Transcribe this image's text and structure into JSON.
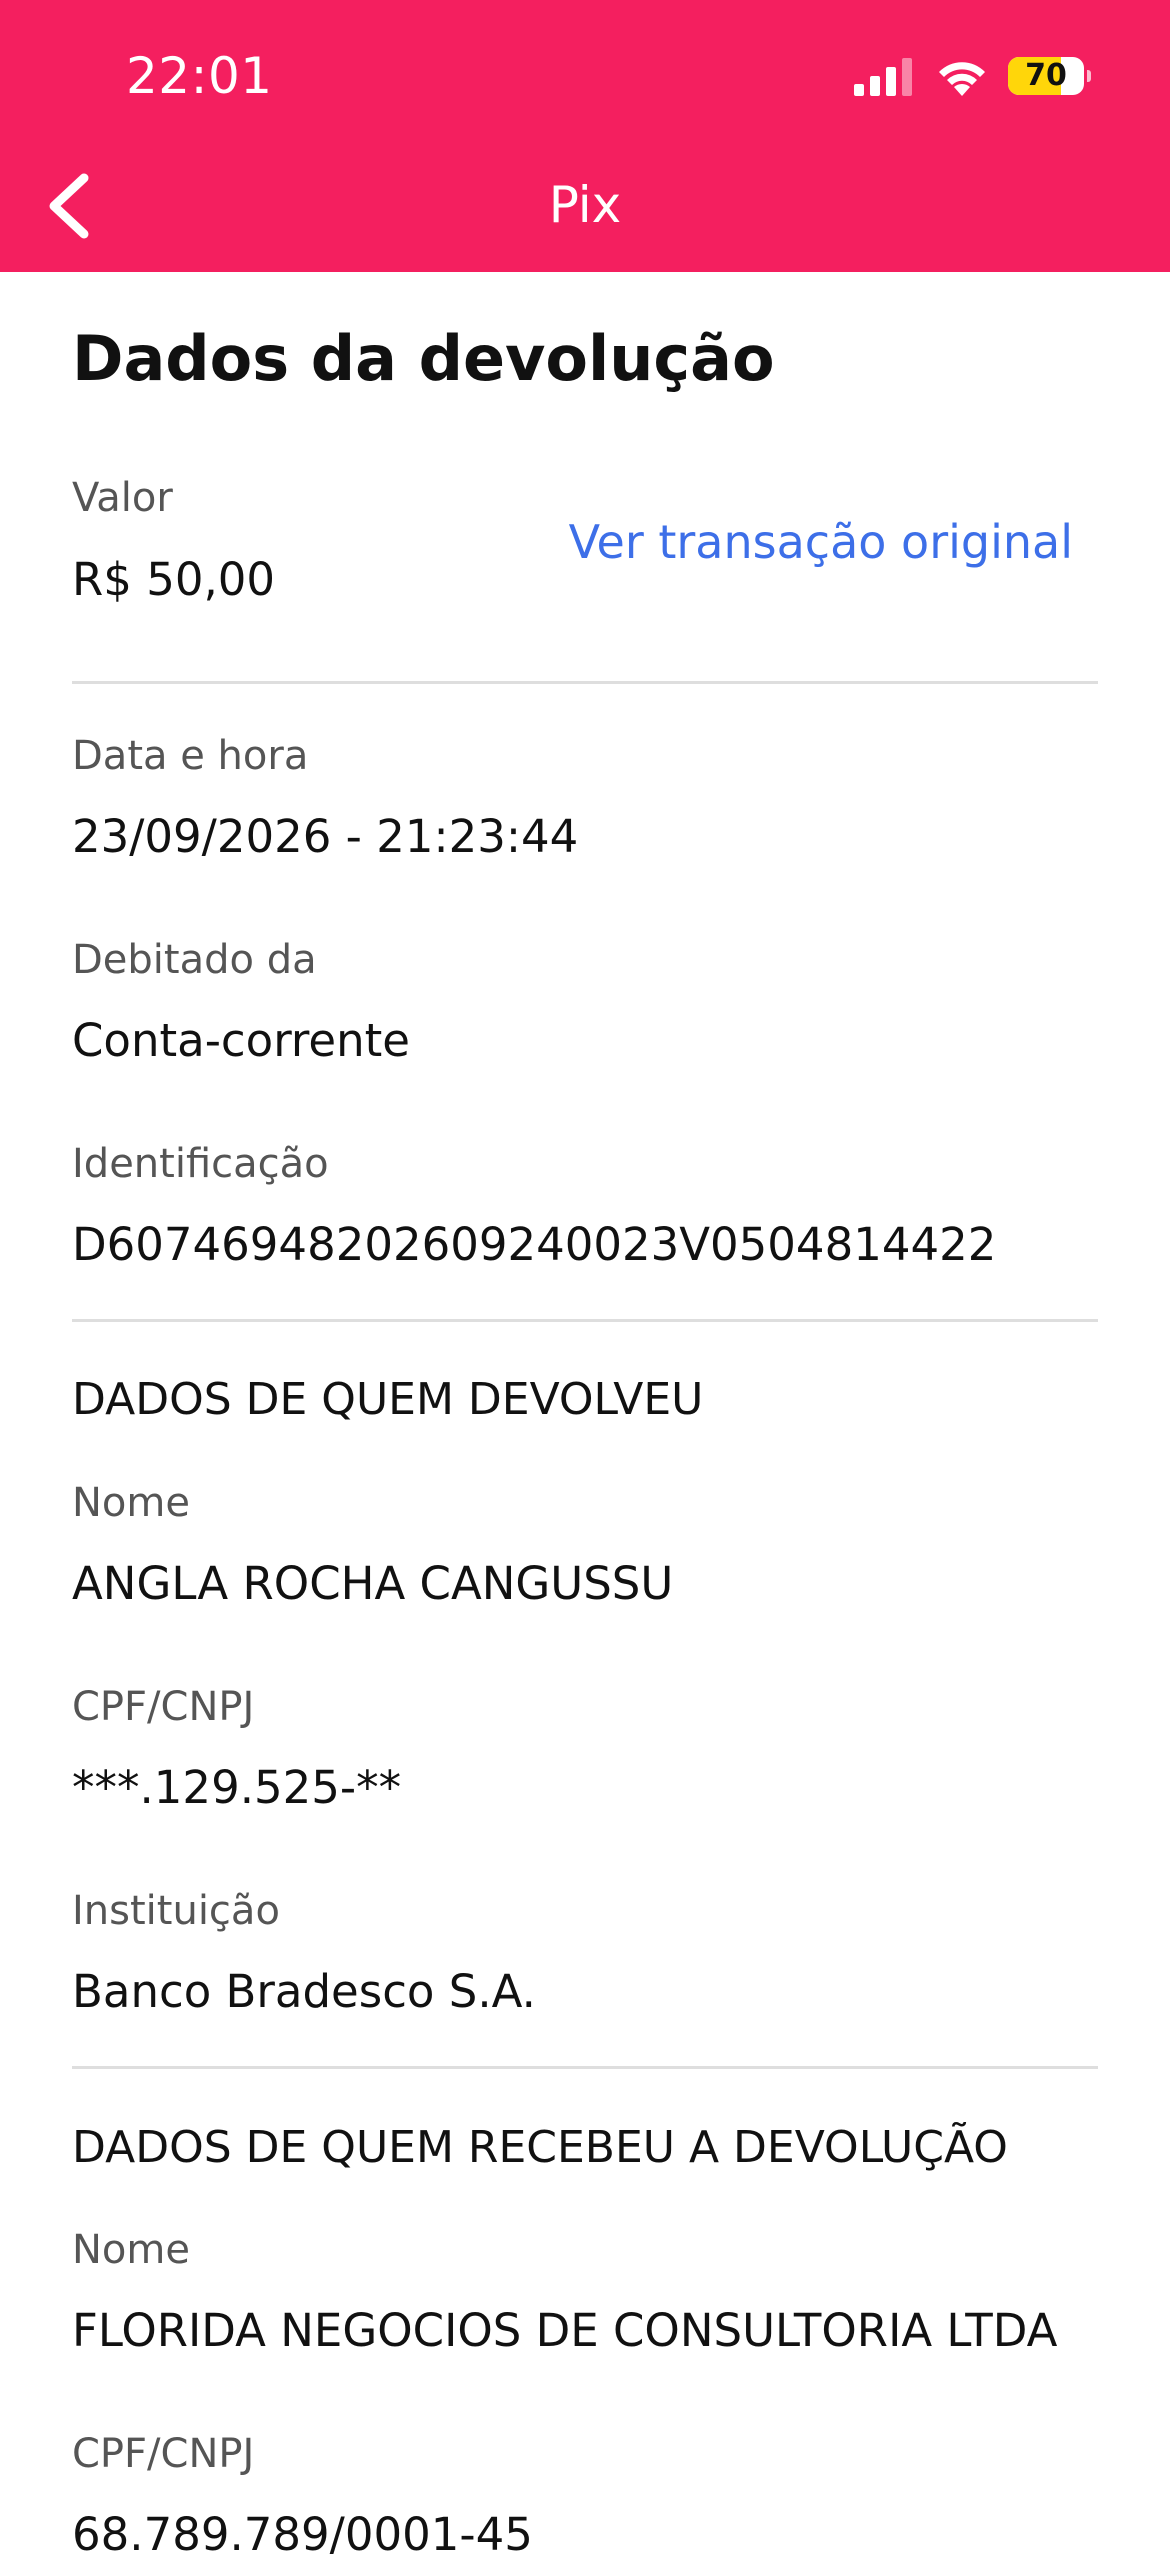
{
  "status_bar": {
    "time": "22:01",
    "battery": "70",
    "battery_fraction": 0.7
  },
  "nav": {
    "title": "Pix",
    "back_icon": "chevron-left-icon"
  },
  "page": {
    "title": "Dados da devolução"
  },
  "summary": {
    "valor_label": "Valor",
    "valor_value": "R$ 50,00",
    "link_label": "Ver transação original",
    "data_label": "Data e hora",
    "data_value": "23/09/2026 - 21:23:44",
    "debitado_label": "Debitado da",
    "debitado_value": "Conta-corrente",
    "id_label": "Identificação",
    "id_value": "D60746948202609240023V0504814422"
  },
  "devolveu": {
    "section_title": "DADOS DE QUEM DEVOLVEU",
    "nome_label": "Nome",
    "nome_value": "ANGLA ROCHA CANGUSSU",
    "cpf_label": "CPF/CNPJ",
    "cpf_value": "***.129.525-**",
    "inst_label": "Instituição",
    "inst_value": "Banco Bradesco S.A."
  },
  "recebeu": {
    "section_title": "DADOS DE QUEM RECEBEU A DEVOLUÇÃO",
    "nome_label": "Nome",
    "nome_value": "FLORIDA NEGOCIOS DE CONSULTORIA LTDA",
    "cpf_label": "CPF/CNPJ",
    "cpf_value": "68.789.789/0001-45"
  },
  "colors": {
    "header": "#f41f5f",
    "link": "#3d6fe8",
    "battery_fill": "#ffd60a"
  }
}
